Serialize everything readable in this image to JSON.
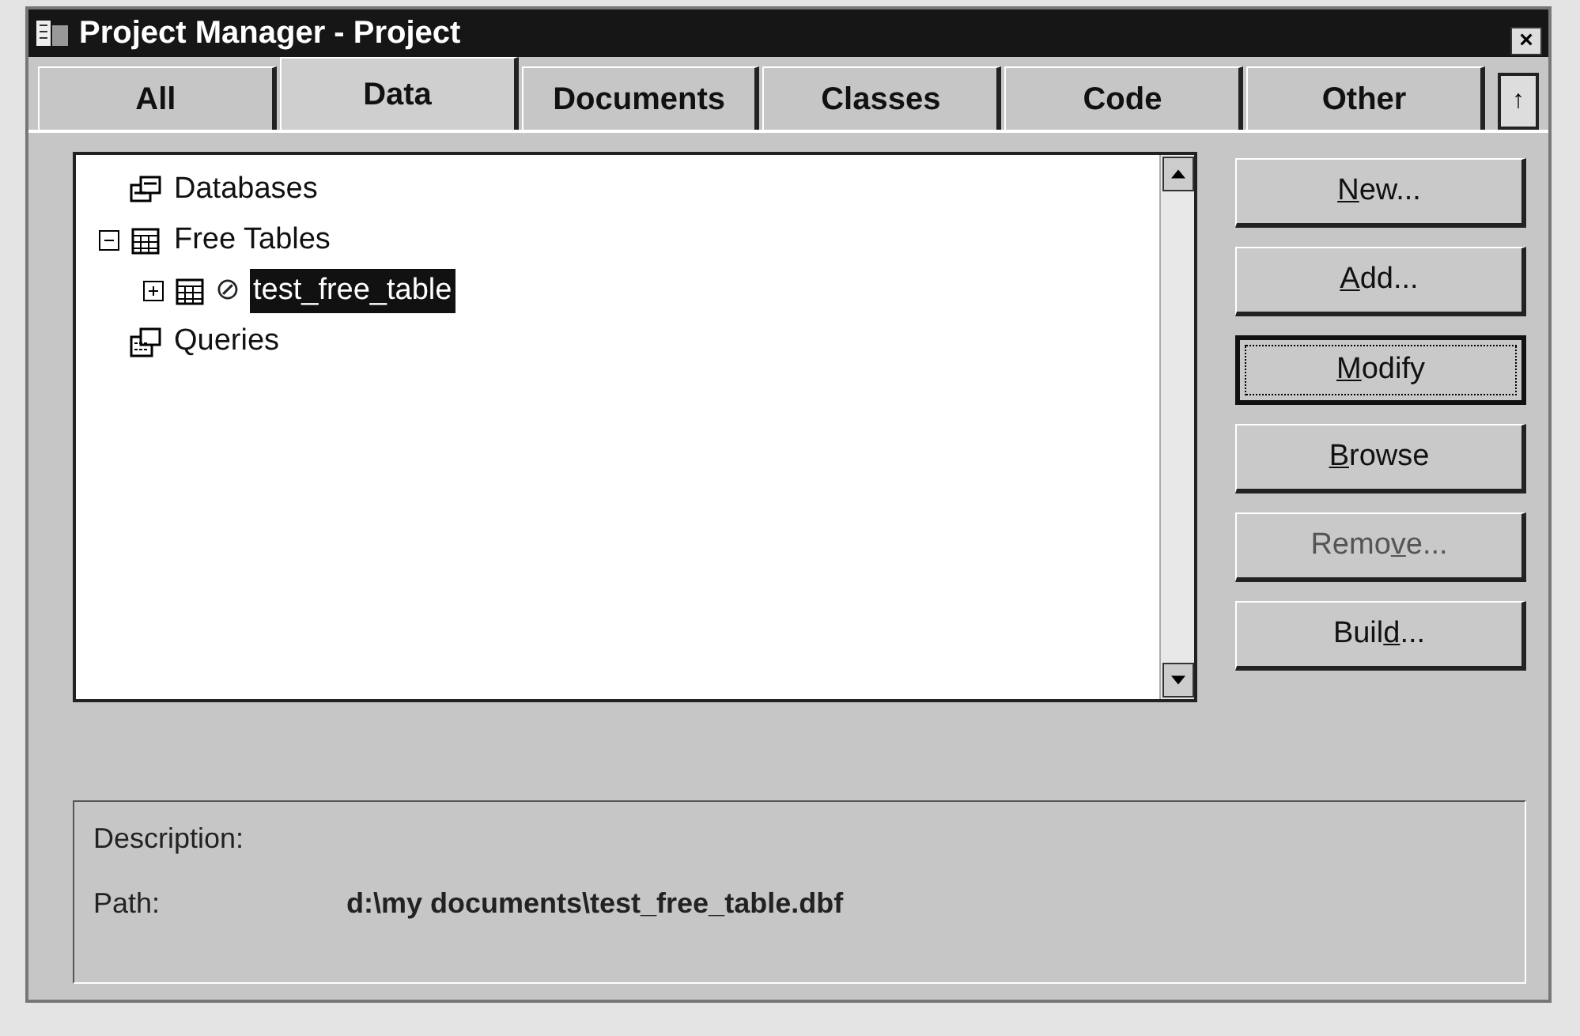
{
  "window": {
    "title": "Project Manager - Project",
    "close": "×"
  },
  "tabs": [
    {
      "label": "All",
      "selected": false
    },
    {
      "label": "Data",
      "selected": true
    },
    {
      "label": "Documents",
      "selected": false
    },
    {
      "label": "Classes",
      "selected": false
    },
    {
      "label": "Code",
      "selected": false
    },
    {
      "label": "Other",
      "selected": false
    }
  ],
  "collapse_button": "↑",
  "tree": [
    {
      "label": "Databases",
      "kind": "databases",
      "selected": false
    },
    {
      "label": "Free Tables",
      "kind": "tables",
      "selected": false,
      "expanded": true,
      "children": [
        {
          "label": "test_free_table",
          "kind": "table",
          "selected": true,
          "expanded": false,
          "excluded_mark": "⊘"
        }
      ]
    },
    {
      "label": "Queries",
      "kind": "queries",
      "selected": false
    }
  ],
  "buttons": [
    {
      "key": "N",
      "after": "ew...",
      "focused": false,
      "disabled": false
    },
    {
      "key": "A",
      "after": "dd...",
      "focused": false,
      "disabled": false
    },
    {
      "key": "M",
      "after": "odify",
      "focused": true,
      "disabled": false
    },
    {
      "key": "B",
      "after": "rowse",
      "focused": false,
      "disabled": false
    },
    {
      "before": "Remo",
      "key": "v",
      "after": "e...",
      "focused": false,
      "disabled": true
    },
    {
      "before": "Buil",
      "key": "d",
      "after": "...",
      "focused": false,
      "disabled": false
    }
  ],
  "description": {
    "label": "Description:"
  },
  "path": {
    "label": "Path:",
    "value": "d:\\my documents\\test_free_table.dbf"
  }
}
